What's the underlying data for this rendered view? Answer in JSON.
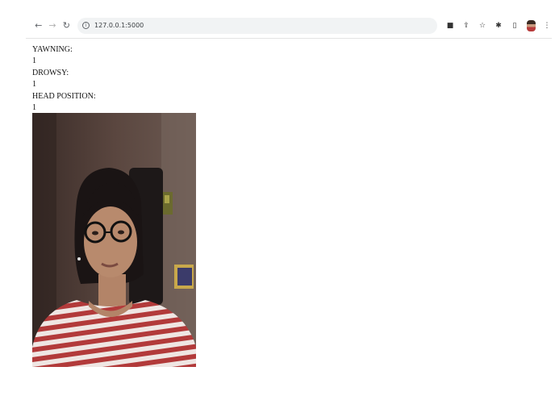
{
  "browser": {
    "url": "127.0.0.1:5000",
    "icons": {
      "back": "arrow-left-icon",
      "forward": "arrow-right-icon",
      "reload": "reload-icon",
      "site_info": "info-icon",
      "camera": "camera-icon",
      "share": "share-icon",
      "bookmark": "star-icon",
      "extensions": "puzzle-icon",
      "sidepanel": "side-panel-icon",
      "profile": "profile-avatar",
      "menu": "kebab-menu-icon"
    }
  },
  "page": {
    "yawning_label": "YAWNING:",
    "yawning_value": "1",
    "drowsy_label": "DROWSY:",
    "drowsy_value": "1",
    "head_position_label": "HEAD POSITION:",
    "head_position_value": "1"
  },
  "colors": {
    "shirt_stripe": "#b23a3a",
    "shirt_base": "#efe6e3",
    "wall": "#4b3a35"
  }
}
